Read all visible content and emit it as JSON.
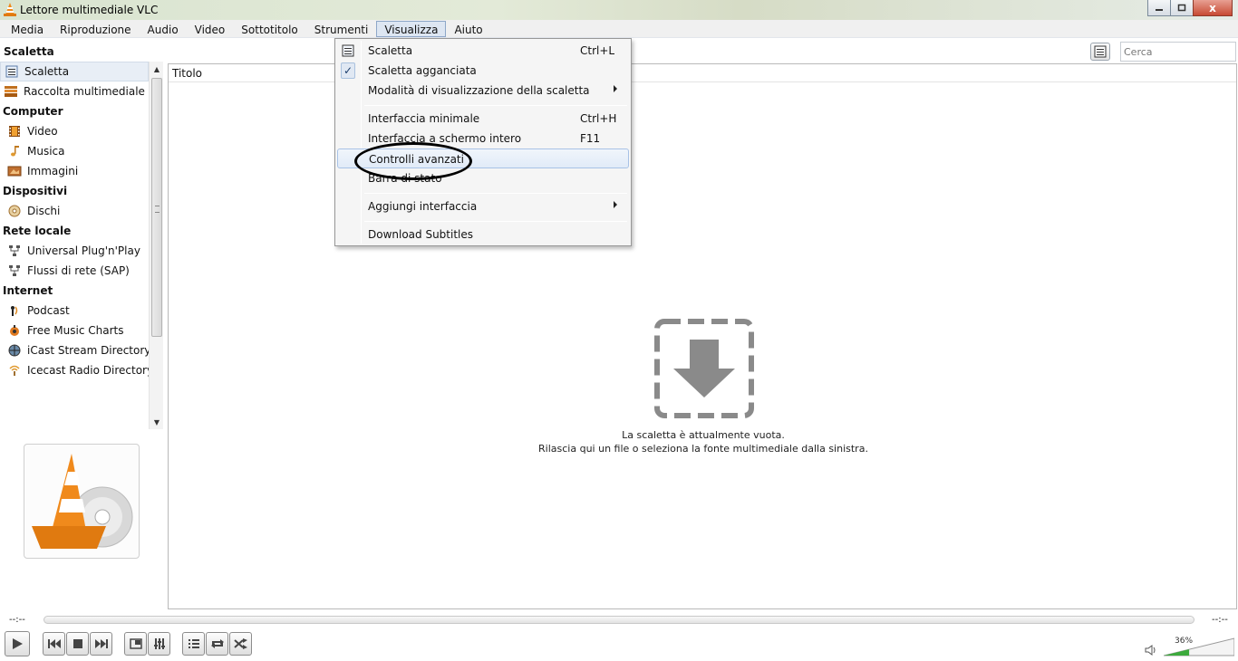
{
  "window": {
    "title": "Lettore multimediale VLC",
    "minimize_label": "",
    "maximize_label": "",
    "close_label": "x"
  },
  "menubar": {
    "items": [
      {
        "label": "Media"
      },
      {
        "label": "Riproduzione"
      },
      {
        "label": "Audio"
      },
      {
        "label": "Video"
      },
      {
        "label": "Sottotitolo"
      },
      {
        "label": "Strumenti"
      },
      {
        "label": "Visualizza",
        "active": true
      },
      {
        "label": "Aiuto"
      }
    ]
  },
  "sidebar": {
    "header": "Scaletta",
    "rows": [
      {
        "label": "Scaletta",
        "icon": "playlist-icon"
      },
      {
        "label": "Raccolta multimediale",
        "icon": "library-icon"
      },
      {
        "label": "Computer",
        "category": true
      },
      {
        "label": "Video",
        "icon": "film-icon"
      },
      {
        "label": "Musica",
        "icon": "music-note-icon"
      },
      {
        "label": "Immagini",
        "icon": "picture-icon"
      },
      {
        "label": "Dispositivi",
        "category": true
      },
      {
        "label": "Dischi",
        "icon": "disc-icon"
      },
      {
        "label": "Rete locale",
        "category": true
      },
      {
        "label": "Universal Plug'n'Play",
        "icon": "network-icon"
      },
      {
        "label": "Flussi di rete (SAP)",
        "icon": "network-icon"
      },
      {
        "label": "Internet",
        "category": true
      },
      {
        "label": "Podcast",
        "icon": "podcast-icon"
      },
      {
        "label": "Free Music Charts",
        "icon": "charts-icon"
      },
      {
        "label": "iCast Stream Directory",
        "icon": "globe-icon"
      },
      {
        "label": "Icecast Radio Directory",
        "icon": "radio-icon"
      }
    ]
  },
  "search": {
    "placeholder": "Cerca"
  },
  "playlist": {
    "column_title": "Titolo",
    "empty_line1": "La scaletta è attualmente vuota.",
    "empty_line2": "Rilascia qui un file o seleziona la fonte multimediale dalla sinistra."
  },
  "view_menu": {
    "items": [
      {
        "label": "Scaletta",
        "shortcut": "Ctrl+L",
        "icon": "playlist-icon"
      },
      {
        "label": "Scaletta agganciata",
        "shortcut": "",
        "checked": true
      },
      {
        "label": "Modalità di visualizzazione della scaletta",
        "shortcut": "",
        "submenu": true
      },
      {
        "label": "Interfaccia minimale",
        "shortcut": "Ctrl+H"
      },
      {
        "label": "Interfaccia a schermo intero",
        "shortcut": "F11"
      },
      {
        "label": "Controlli avanzati",
        "shortcut": "",
        "highlighted": true
      },
      {
        "label": "Barra di stato",
        "shortcut": ""
      },
      {
        "label": "Aggiungi interfaccia",
        "shortcut": "",
        "submenu": true
      },
      {
        "label": "Download Subtitles",
        "shortcut": ""
      }
    ]
  },
  "player": {
    "time_elapsed": "--:--",
    "time_total": "--:--",
    "volume_percent": "36%",
    "volume_level": 0.36
  },
  "colors": {
    "highlight_border": "#a8c2e6",
    "vlc_orange": "#f08a1c",
    "accent_green": "#3caa3c"
  }
}
